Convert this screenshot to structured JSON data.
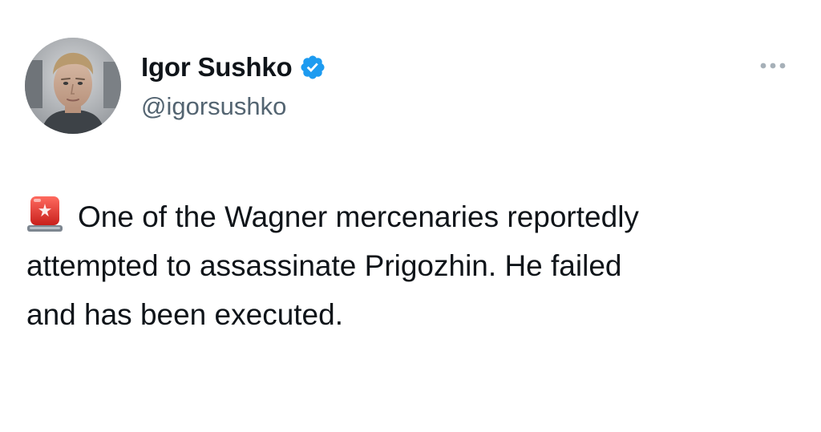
{
  "author": {
    "display_name": "Igor Sushko",
    "handle": "@igorsushko",
    "verified": true,
    "avatar_icon": "profile-photo"
  },
  "menu": {
    "icon": "more-horizontal-icon"
  },
  "tweet": {
    "emoji_icon": "police-car-light-icon",
    "lines": [
      "One of the Wagner mercenaries reportedly",
      "attempted to assassinate Prigozhin. He failed",
      "and has been executed."
    ]
  },
  "colors": {
    "verified_blue": "#1d9bf0",
    "secondary_text": "#536471",
    "primary_text": "#0f1419",
    "siren_red": "#e0322b"
  }
}
